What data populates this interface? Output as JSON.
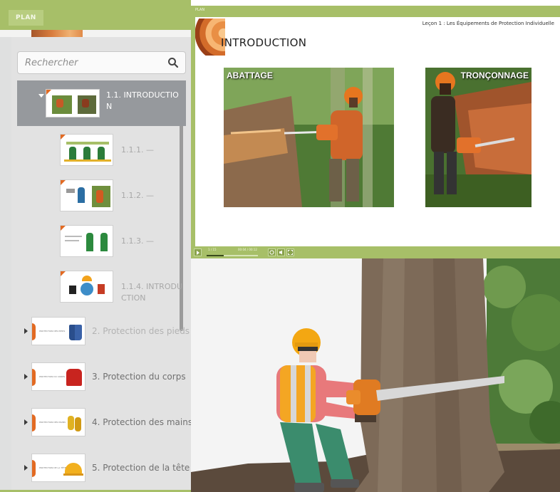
{
  "plan": {
    "tab_label": "PLAN",
    "search_placeholder": "Rechercher",
    "active_section": {
      "label": "1.1. INTRODUCTION"
    },
    "sub_items": [
      {
        "label": "1.1.1. —"
      },
      {
        "label": "1.1.2. —"
      },
      {
        "label": "1.1.3. —"
      },
      {
        "label": "1.1.4. INTRODUCTION"
      }
    ],
    "sections": [
      {
        "label": "2. Protection des pieds",
        "thumb_text": "PROTECTION DES PIEDS"
      },
      {
        "label": "3. Protection du corps",
        "thumb_text": "PROTECTION DU CORPS"
      },
      {
        "label": "4. Protection des mains",
        "thumb_text": "PROTECTION DES MAINS"
      },
      {
        "label": "5. Protection de la tête",
        "thumb_text": "PROTECTION DE LA TÊTE"
      }
    ]
  },
  "player": {
    "top_label": "PLAN",
    "lesson_title": "Leçon 1 : Les Équipements de Protection Individuelle",
    "slide_title": "INTRODUCTION",
    "photo_left_caption": "ABATTAGE",
    "photo_right_caption": "TRONÇONNAGE",
    "slide_counter": "1 / 15",
    "time": "00:04 / 00:12",
    "progress_fraction": 0.33
  },
  "colors": {
    "accent_green": "#a7bf68",
    "active_row": "#96999d",
    "brand_orange": "#e26a22"
  }
}
